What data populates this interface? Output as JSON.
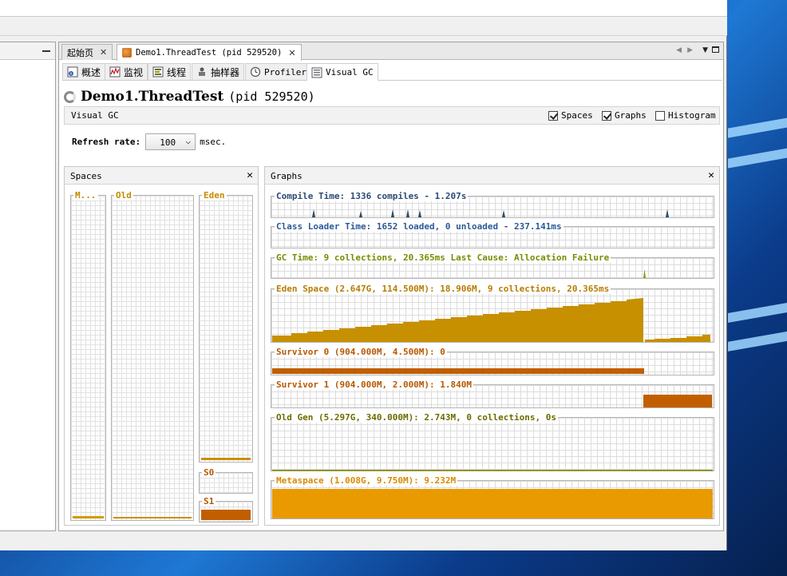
{
  "colors": {
    "eden": "#c79000",
    "survivor": "#c15f00",
    "metaspace": "#e89a00",
    "compile_label": "#2a4a76",
    "gc_label": "#7a8a00"
  },
  "left_panel": {
    "minimize_icon": "minimize-icon"
  },
  "doc_tabs": [
    {
      "label": "起始页",
      "active": false
    },
    {
      "label": "Demo1.ThreadTest (pid 529520)",
      "active": true
    }
  ],
  "sub_tabs": [
    {
      "label": "概述",
      "icon": "info-icon"
    },
    {
      "label": "监视",
      "icon": "monitor-chart-icon"
    },
    {
      "label": "线程",
      "icon": "threads-icon"
    },
    {
      "label": "抽样器",
      "icon": "sampler-icon"
    },
    {
      "label": "Profiler",
      "icon": "profiler-clock-icon"
    },
    {
      "label": "Visual GC",
      "icon": "visual-gc-icon"
    }
  ],
  "title": {
    "app": "Demo1.ThreadTest",
    "pid": "(pid 529520)"
  },
  "visual_gc": {
    "label": "Visual GC",
    "checkboxes": [
      {
        "label": "Spaces",
        "checked": true
      },
      {
        "label": "Graphs",
        "checked": true
      },
      {
        "label": "Histogram",
        "checked": false
      }
    ]
  },
  "refresh": {
    "label": "Refresh rate:",
    "value": "100",
    "unit": "msec."
  },
  "spaces_panel": {
    "title": "Spaces",
    "spaces": [
      {
        "label": "M...",
        "fill_fraction": 0.01
      },
      {
        "label": "Old",
        "fill_fraction": 0.003
      },
      {
        "label": "Eden",
        "fill_fraction": 0.01
      },
      {
        "label": "S0",
        "fill_fraction": 0.0
      },
      {
        "label": "S1",
        "fill_fraction": 0.92
      }
    ]
  },
  "graphs_panel": {
    "title": "Graphs",
    "graphs": [
      {
        "key": "compile",
        "label": "Compile Time: 1336 compiles - 1.207s"
      },
      {
        "key": "classloader",
        "label": "Class Loader Time: 1652 loaded, 0 unloaded - 237.141ms"
      },
      {
        "key": "gc",
        "label": "GC Time: 9 collections, 20.365ms Last Cause: Allocation Failure"
      },
      {
        "key": "eden",
        "label": "Eden Space (2.647G, 114.500M): 18.906M, 9 collections, 20.365ms"
      },
      {
        "key": "s0",
        "label": "Survivor 0 (904.000M, 4.500M): 0"
      },
      {
        "key": "s1",
        "label": "Survivor 1 (904.000M, 2.000M): 1.840M"
      },
      {
        "key": "old",
        "label": "Old Gen (5.297G, 340.000M): 2.743M, 0 collections, 0s"
      },
      {
        "key": "meta",
        "label": "Metaspace (1.008G, 9.750M): 9.232M"
      }
    ]
  }
}
